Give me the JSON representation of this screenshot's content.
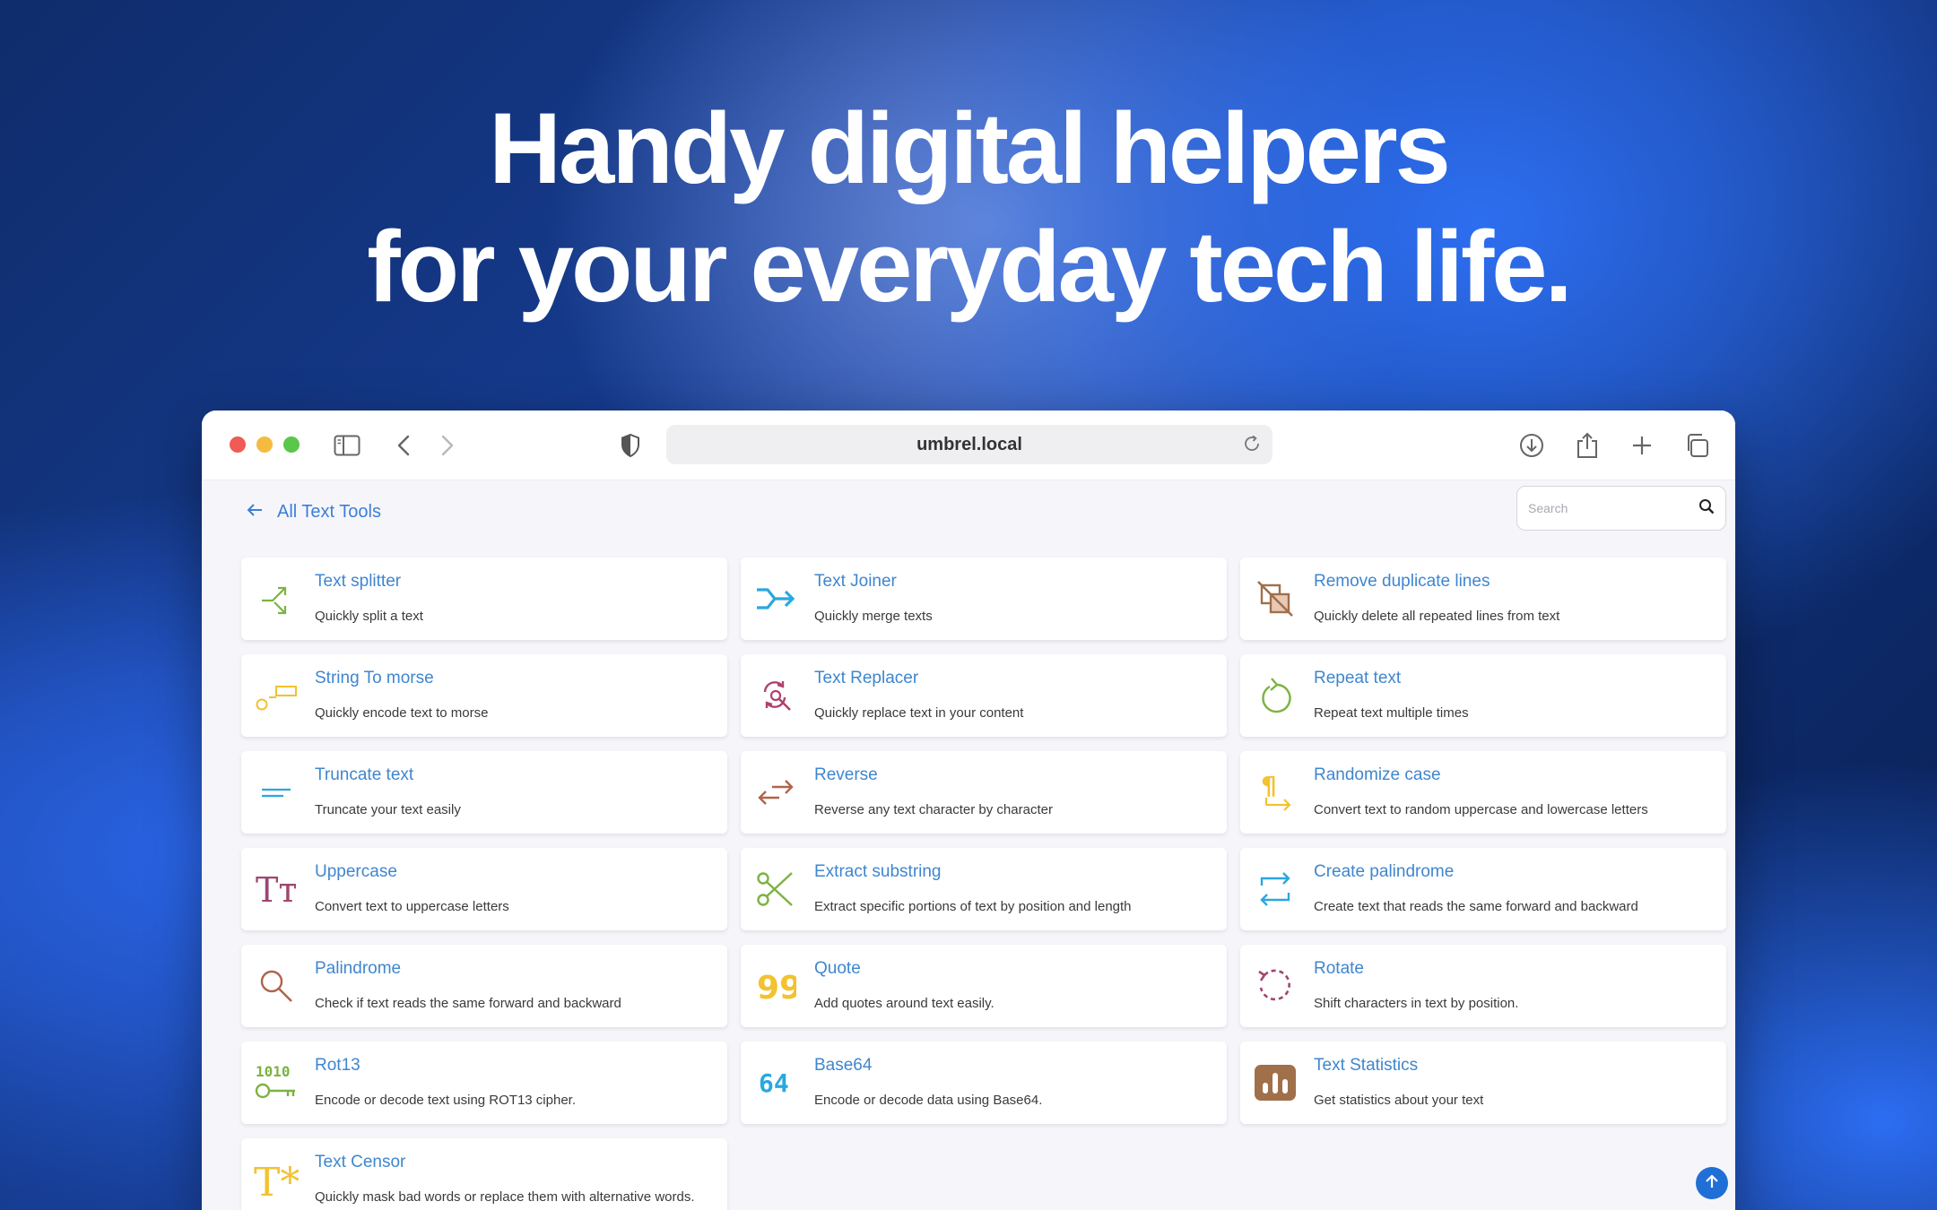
{
  "hero": {
    "line1": "Handy digital helpers",
    "line2": "for your everyday tech life."
  },
  "browser": {
    "url": "umbrel.local"
  },
  "nav": {
    "back_label": "All Text Tools"
  },
  "search": {
    "placeholder": "Search"
  },
  "tools": [
    {
      "title": "Text splitter",
      "desc": "Quickly split a text",
      "icon": "split-arrows-icon",
      "color": "#7cb342"
    },
    {
      "title": "Text Joiner",
      "desc": "Quickly merge texts",
      "icon": "merge-arrow-icon",
      "color": "#29a8e0"
    },
    {
      "title": "Remove duplicate lines",
      "desc": "Quickly delete all repeated lines from text",
      "icon": "remove-duplicate-icon",
      "color": "#a0704a"
    },
    {
      "title": "String To morse",
      "desc": "Quickly encode text to morse",
      "icon": "morse-icon",
      "color": "#f2c230"
    },
    {
      "title": "Text Replacer",
      "desc": "Quickly replace text in your content",
      "icon": "find-replace-icon",
      "color": "#b0426e"
    },
    {
      "title": "Repeat text",
      "desc": "Repeat text multiple times",
      "icon": "repeat-icon",
      "color": "#7cb342"
    },
    {
      "title": "Truncate text",
      "desc": "Truncate your text easily",
      "icon": "truncate-lines-icon",
      "color": "#29a8e0"
    },
    {
      "title": "Reverse",
      "desc": "Reverse any text character by character",
      "icon": "swap-arrows-icon",
      "color": "#b0644a"
    },
    {
      "title": "Randomize case",
      "desc": "Convert text to random uppercase and lowercase letters",
      "icon": "pilcrow-arrow-icon",
      "color": "#f2c230"
    },
    {
      "title": "Uppercase",
      "desc": "Convert text to uppercase letters",
      "icon": "text-case-icon",
      "color": "#a04670"
    },
    {
      "title": "Extract substring",
      "desc": "Extract specific portions of text by position and length",
      "icon": "scissors-icon",
      "color": "#7cb342"
    },
    {
      "title": "Create palindrome",
      "desc": "Create text that reads the same forward and backward",
      "icon": "palindrome-arrows-icon",
      "color": "#29a8e0"
    },
    {
      "title": "Palindrome",
      "desc": "Check if text reads the same forward and backward",
      "icon": "magnifier-icon",
      "color": "#b0644a"
    },
    {
      "title": "Quote",
      "desc": "Add quotes around text easily.",
      "icon": "quote-icon",
      "color": "#f2c230"
    },
    {
      "title": "Rotate",
      "desc": "Shift characters in text by position.",
      "icon": "rotate-icon",
      "color": "#a04670"
    },
    {
      "title": "Rot13",
      "desc": "Encode or decode text using ROT13 cipher.",
      "icon": "binary-key-icon",
      "color": "#7cb342"
    },
    {
      "title": "Base64",
      "desc": "Encode or decode data using Base64.",
      "icon": "base64-icon",
      "color": "#29a8e0"
    },
    {
      "title": "Text Statistics",
      "desc": "Get statistics about your text",
      "icon": "bar-chart-icon",
      "color": "#a0704a"
    },
    {
      "title": "Text Censor",
      "desc": "Quickly mask bad words or replace them with alternative words.",
      "icon": "text-star-icon",
      "color": "#f2c230"
    }
  ],
  "icon_labels": {
    "morse": "1010",
    "quote": "99",
    "base64": "64",
    "case": "Tт",
    "censor": "T*",
    "pilcrow": "¶"
  }
}
